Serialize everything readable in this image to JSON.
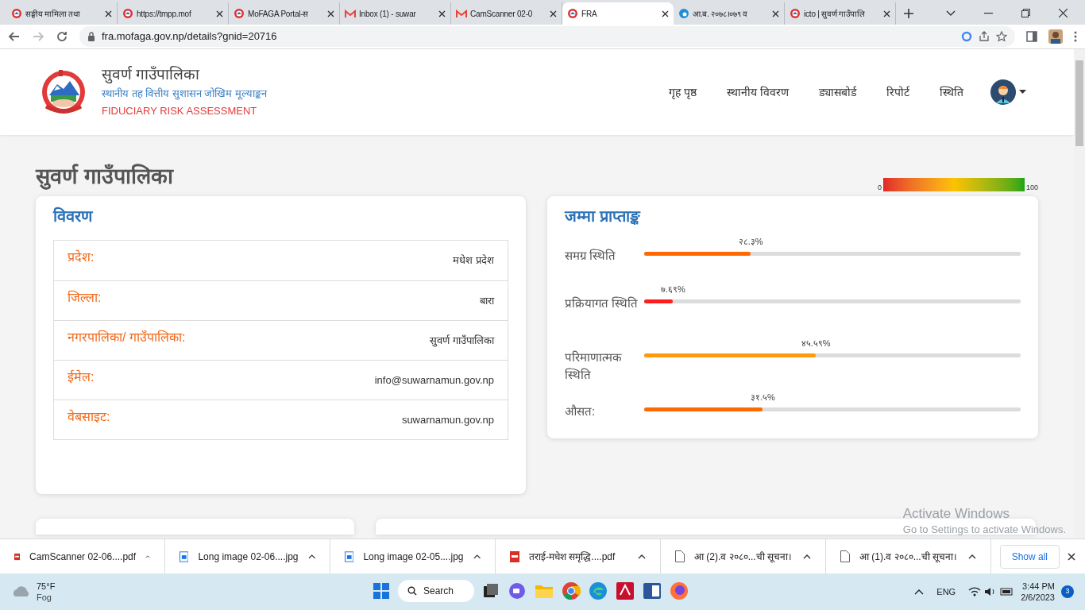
{
  "browser": {
    "tabs": [
      {
        "title": "सङ्घीय मामिला तथा",
        "selected": false,
        "kind": "emblem"
      },
      {
        "title": "https://tmpp.mof",
        "selected": false,
        "kind": "emblem"
      },
      {
        "title": "MoFAGA Portal-स",
        "selected": false,
        "kind": "emblem"
      },
      {
        "title": "Inbox (1) - suwar",
        "selected": false,
        "kind": "mail"
      },
      {
        "title": "CamScanner 02-0",
        "selected": false,
        "kind": "mail"
      },
      {
        "title": "FRA",
        "selected": true,
        "kind": "emblem"
      },
      {
        "title": "आ.ब. २०७८।०७९ व",
        "selected": false,
        "kind": "edge"
      },
      {
        "title": "icto | सुवर्ण गाउँपालि",
        "selected": false,
        "kind": "emblem"
      }
    ],
    "url": "fra.mofaga.gov.np/details?gnid=20716"
  },
  "header": {
    "title": "सुवर्ण गाउँपालिका",
    "subtitle": "स्थानीय तह वित्तीय सुशासन जोखिम मूल्याङ्कन",
    "tagline": "FIDUCIARY RISK ASSESSMENT",
    "nav": [
      {
        "label": "गृह पृष्ठ"
      },
      {
        "label": "स्थानीय विवरण"
      },
      {
        "label": "ड्यासबोर्ड"
      },
      {
        "label": "रिपोर्ट"
      },
      {
        "label": "स्थिति"
      }
    ]
  },
  "page_title": "सुवर्ण गाउँपालिका",
  "legend": {
    "min": "0",
    "max": "100"
  },
  "details": {
    "title": "विवरण",
    "rows": [
      {
        "label": "प्रदेश:",
        "value": "मधेश प्रदेश"
      },
      {
        "label": "जिल्ला:",
        "value": "बारा"
      },
      {
        "label": "नगरपालिका/ गाउँपालिका:",
        "value": "सुवर्ण गाउँपालिका"
      },
      {
        "label": "ईमेल:",
        "value": "info@suwarnamun.gov.np"
      },
      {
        "label": "वेबसाइट:",
        "value": "suwarnamun.gov.np"
      }
    ]
  },
  "scores": {
    "title": "जम्मा प्राप्ताङ्क",
    "items": [
      {
        "label": "समग्र स्थिति",
        "reading": "२८.३%",
        "level": 0.283,
        "color": "#ff6a00"
      },
      {
        "label": "प्रक्रियागत स्थिति",
        "reading": "७.६९%",
        "level": 0.0769,
        "color": "#ff1e1e"
      },
      {
        "label": "परिमाणात्मक स्थिति",
        "reading": "४५.५९%",
        "level": 0.4559,
        "color": "#ff9a0a"
      },
      {
        "label": "औसत:",
        "reading": "३१.५%",
        "level": 0.315,
        "color": "#ff6a00"
      }
    ]
  },
  "activation": {
    "title": "Activate Windows",
    "text": "Go to Settings to activate Windows."
  },
  "downloads": {
    "items": [
      {
        "name": "CamScanner 02-06....pdf",
        "kind": "pdf"
      },
      {
        "name": "Long image 02-06....jpg",
        "kind": "image"
      },
      {
        "name": "Long image 02-05....jpg",
        "kind": "image"
      },
      {
        "name": "तराई-मधेश समृद्धि....pdf",
        "kind": "pdf"
      },
      {
        "name": "आ (2).व २०८०...ची सूचना।",
        "kind": "file"
      },
      {
        "name": "आ (1).व २०८०...ची सूचना।",
        "kind": "file"
      }
    ],
    "show_all": "Show all"
  },
  "taskbar": {
    "weather_temp": "75°F",
    "weather_text": "Fog",
    "search": "Search",
    "language": "ENG",
    "time": "3:44 PM",
    "date": "2/6/2023",
    "badge": "3"
  }
}
